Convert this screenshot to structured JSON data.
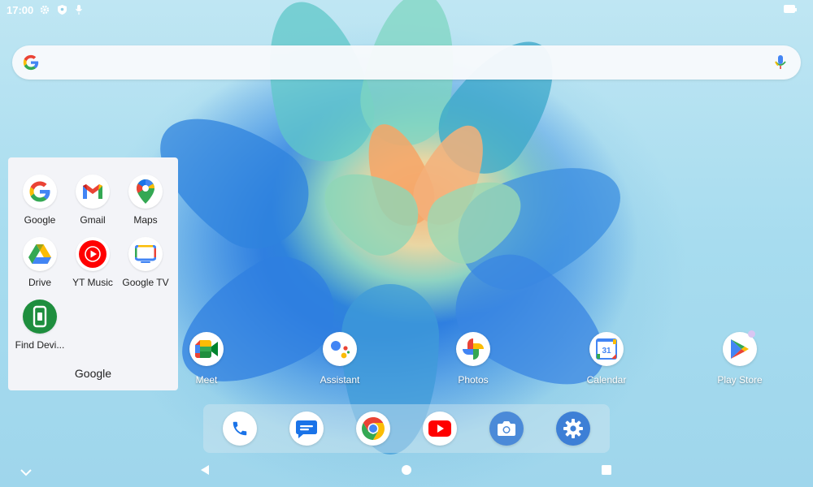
{
  "status_bar": {
    "time": "17:00",
    "icons": [
      "gear-icon",
      "shield-icon",
      "microphone-small-icon"
    ],
    "battery_icon": "battery-icon"
  },
  "search_bar": {
    "placeholder": "",
    "left_icon": "google-g-icon",
    "right_icon": "mic-icon"
  },
  "folder": {
    "name": "Google",
    "apps": [
      {
        "label": "Google",
        "icon": "google-g-icon"
      },
      {
        "label": "Gmail",
        "icon": "gmail-icon"
      },
      {
        "label": "Maps",
        "icon": "maps-icon"
      },
      {
        "label": "Drive",
        "icon": "drive-icon"
      },
      {
        "label": "YT Music",
        "icon": "yt-music-icon"
      },
      {
        "label": "Google TV",
        "icon": "google-tv-icon"
      },
      {
        "label": "Find Devi...",
        "icon": "find-device-icon"
      }
    ]
  },
  "home_apps": [
    {
      "label": "Meet",
      "icon": "meet-icon"
    },
    {
      "label": "Assistant",
      "icon": "assistant-icon"
    },
    {
      "label": "Photos",
      "icon": "photos-icon"
    },
    {
      "label": "Calendar",
      "icon": "calendar-icon",
      "icon_text": "31"
    },
    {
      "label": "Play Store",
      "icon": "play-store-icon"
    }
  ],
  "dock": [
    {
      "icon": "phone-icon"
    },
    {
      "icon": "messages-icon"
    },
    {
      "icon": "chrome-icon"
    },
    {
      "icon": "youtube-icon"
    },
    {
      "icon": "camera-icon"
    },
    {
      "icon": "settings-icon"
    }
  ],
  "nav_bar": {
    "buttons": [
      "chevron-down-icon",
      "back-icon",
      "home-icon",
      "recents-icon"
    ]
  },
  "colors": {
    "google_blue": "#4285F4",
    "google_red": "#EA4335",
    "google_yellow": "#FBBC05",
    "google_green": "#34A853"
  }
}
